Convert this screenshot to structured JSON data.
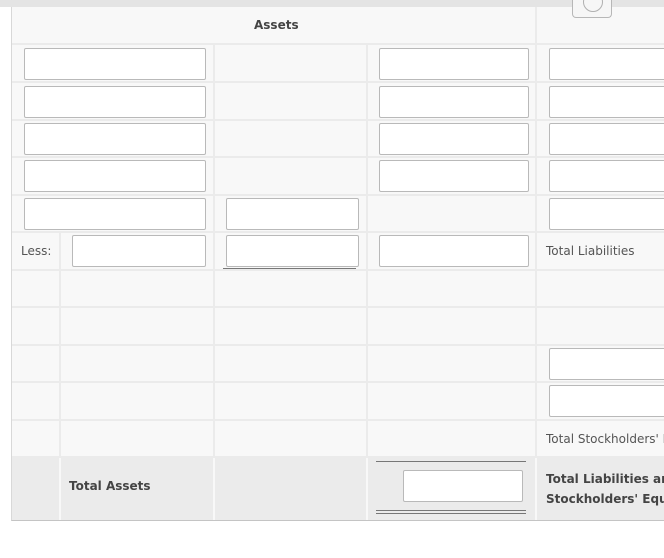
{
  "assets_section": {
    "header": "Assets",
    "less_label": "Less:",
    "total_label": "Total Assets"
  },
  "liabilities_section": {
    "total_liabilities_label": "Total Liabilities",
    "total_equity_label": "Total Stockholders' Equity",
    "total_liab_equity_label": "Total Liabilities and Stockholders' Equity"
  },
  "fields": {
    "asset_item_1": "",
    "asset_item_2": "",
    "asset_item_3": "",
    "asset_item_4": "",
    "asset_item_5": "",
    "asset_amount_1": "",
    "asset_amount_2": "",
    "asset_amount_3": "",
    "asset_amount_4": "",
    "asset_subtotal_5": "",
    "asset_subtotal_less": "",
    "less_item": "",
    "asset_net_amount": "",
    "total_assets_amount": "",
    "liab_item_1": "",
    "liab_item_2": "",
    "liab_item_3": "",
    "liab_item_4": "",
    "liab_item_5": "",
    "equity_item_1": "",
    "equity_item_2": ""
  }
}
